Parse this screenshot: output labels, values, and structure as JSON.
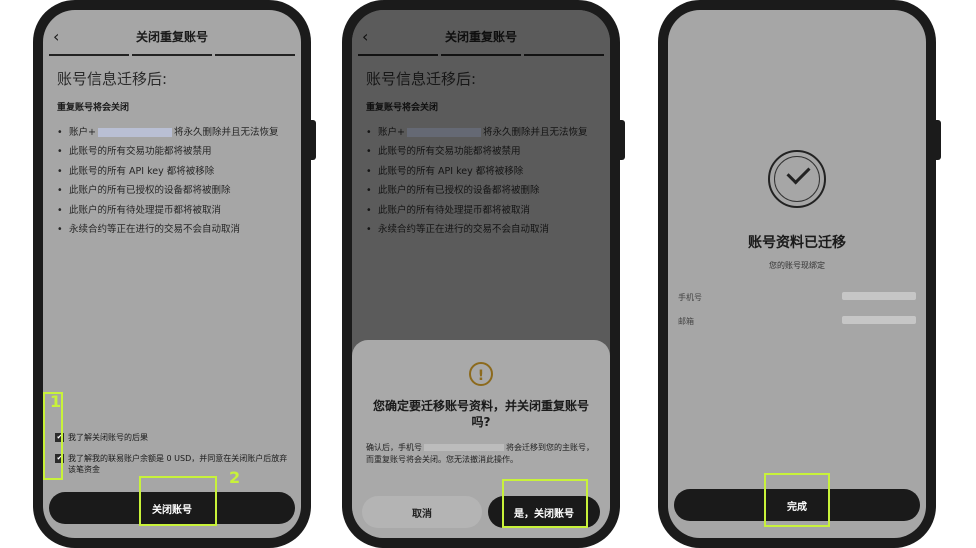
{
  "screen1": {
    "nav_title": "关闭重复账号",
    "back_icon": "chevron-left-icon",
    "heading": "账号信息迁移后:",
    "subheading": "重复账号将会关闭",
    "bullets": [
      {
        "pre": "账户+",
        "post": "将永久删除并且无法恢复"
      },
      {
        "pre": "此账号的所有交易功能都将被禁用",
        "post": ""
      },
      {
        "pre": "此账号的所有 API key 都将被移除",
        "post": ""
      },
      {
        "pre": "此账户的所有已授权的设备都将被删除",
        "post": ""
      },
      {
        "pre": "此账户的所有待处理提币都将被取消",
        "post": ""
      },
      {
        "pre": "永续合约等正在进行的交易不会自动取消",
        "post": ""
      }
    ],
    "checkbox1": "我了解关闭账号的后果",
    "checkbox2": "我了解我的联易账户余额是 0 USD，并同意在关闭账户后放弃该笔资金",
    "button": "关闭账号",
    "marker1": "1",
    "marker2": "2"
  },
  "screen2": {
    "nav_title": "关闭重复账号",
    "heading": "账号信息迁移后:",
    "subheading": "重复账号将会关闭",
    "bullets": [
      {
        "pre": "账户+",
        "post": "将永久删除并且无法恢复"
      },
      {
        "pre": "此账号的所有交易功能都将被禁用",
        "post": ""
      },
      {
        "pre": "此账号的所有 API key 都将被移除",
        "post": ""
      },
      {
        "pre": "此账户的所有已授权的设备都将被删除",
        "post": ""
      },
      {
        "pre": "此账户的所有待处理提币都将被取消",
        "post": ""
      },
      {
        "pre": "永续合约等正在进行的交易不会自动取消",
        "post": ""
      }
    ],
    "dialog_title": "您确定要迁移账号资料，并关闭重复账号吗?",
    "dialog_body_pre": "确认后，手机号",
    "dialog_body_post": "将会迁移到您的主账号，而重复账号将会关闭。您无法撤消此操作。",
    "cancel": "取消",
    "confirm": "是，关闭账号",
    "warn_icon": "warning-icon"
  },
  "screen3": {
    "title": "账号资料已迁移",
    "subtitle": "您的账号现绑定",
    "phone_label": "手机号",
    "email_label": "邮箱",
    "button": "完成",
    "check_icon": "check-circle-icon"
  },
  "colors": {
    "highlight": "#c8f23a",
    "button": "#1a1a1a",
    "screen_bg": "#a6a6a6"
  }
}
